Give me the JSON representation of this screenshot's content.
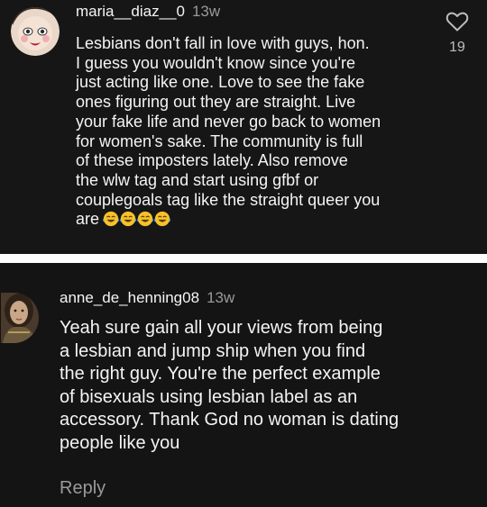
{
  "comments": [
    {
      "username": "maria__diaz__0",
      "time": "13w",
      "text": "Lesbians don't fall in love with guys, hon.\nI guess you wouldn't know since you're\njust acting like one. Love to see the fake\nones figuring out they are straight. Live\nyour fake life and never go back to women\nfor women's sake. The community is full\nof these imposters lately. Also remove\nthe wlw tag and start using gfbf or\ncouplegoals tag like the straight queer you\nare",
      "emoji": "face-with-tears-of-joy",
      "emoji_count": 4,
      "likes": "19",
      "icons": {
        "like": "heart-outline-icon"
      }
    },
    {
      "username": "anne_de_henning08",
      "time": "13w",
      "text": "Yeah sure gain all your views from being\na lesbian and jump ship when you find\nthe right guy. You're the perfect example\nof bisexuals using lesbian label as an\naccessory. Thank God no woman is dating\npeople like you",
      "reply_label": "Reply"
    }
  ],
  "colors": {
    "background": "#141414",
    "text": "#f4f4f4",
    "muted": "#9a9a9a",
    "divider": "#ffffff"
  }
}
